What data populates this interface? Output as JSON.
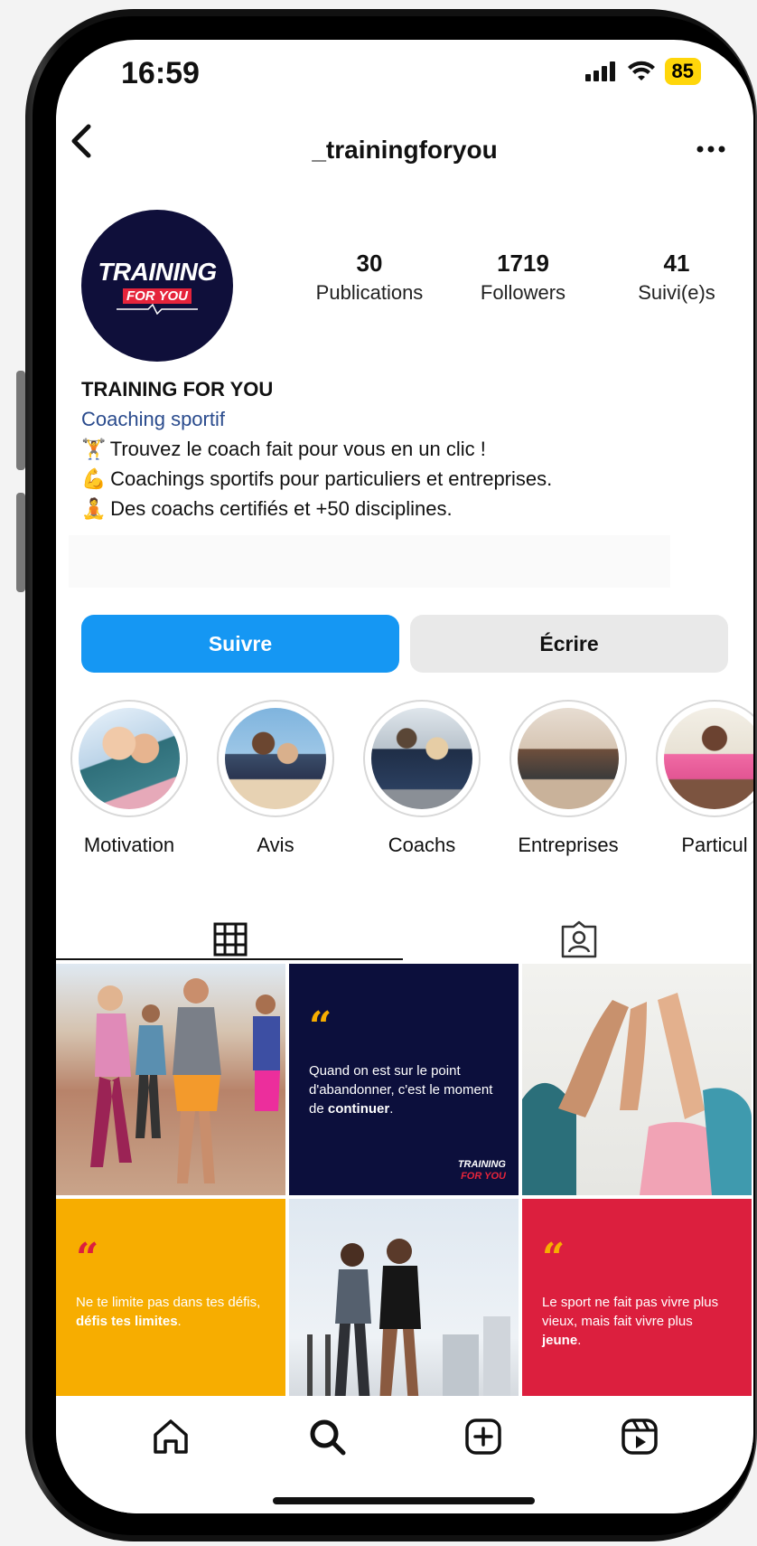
{
  "status_bar": {
    "time": "16:59",
    "battery": "85"
  },
  "header": {
    "username": "_trainingforyou"
  },
  "avatar": {
    "line1": "TRAINING",
    "line2": "FOR YOU"
  },
  "stats": [
    {
      "value": "30",
      "label": "Publications"
    },
    {
      "value": "1719",
      "label": "Followers"
    },
    {
      "value": "41",
      "label": "Suivi(e)s"
    }
  ],
  "bio": {
    "name": "TRAINING FOR YOU",
    "category": "Coaching sportif",
    "lines": [
      "Trouvez le coach fait pour vous en un clic !",
      "Coachings sportifs pour particuliers et entreprises.",
      "Des coachs certifiés et +50 disciplines."
    ]
  },
  "actions": {
    "follow": "Suivre",
    "message": "Écrire"
  },
  "highlights": [
    {
      "label": "Motivation"
    },
    {
      "label": "Avis"
    },
    {
      "label": "Coachs"
    },
    {
      "label": "Entreprises"
    },
    {
      "label": "Particul"
    }
  ],
  "posts": {
    "quote1": {
      "before": "Quand on est sur le point d'abandonner, c'est le moment de ",
      "bold": "continuer",
      "after": "."
    },
    "quote2": {
      "before": "Ne te limite pas dans tes défis, ",
      "bold": "défis tes limites",
      "after": "."
    },
    "quote3": {
      "before": "Le sport ne fait pas vivre plus vieux, mais fait vivre plus ",
      "bold": "jeune",
      "after": "."
    },
    "logo_line1": "TRAINING",
    "logo_line2": "FOR YOU"
  },
  "colors": {
    "accent_blue": "#1597f3",
    "navy": "#0c0f3c",
    "yellow": "#f7ad00",
    "red": "#dc1f3e",
    "battery": "#ffd60a"
  }
}
